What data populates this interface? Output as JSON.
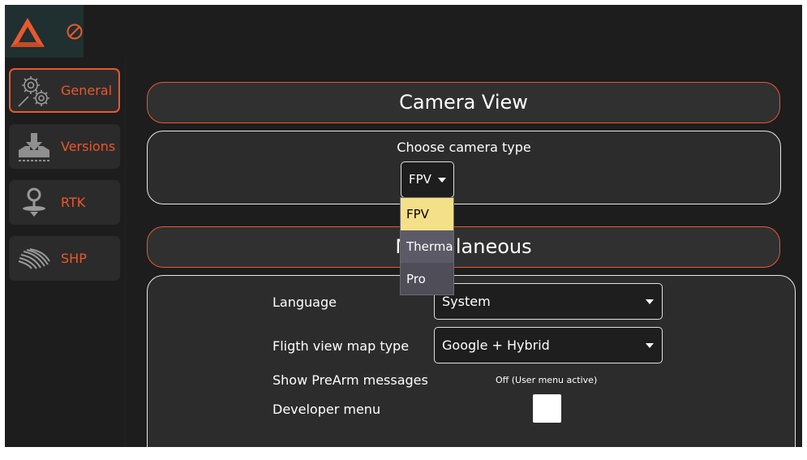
{
  "toolbar": {
    "logo_icon": "orange-triangle-logo-icon",
    "connection_icon": "no-connection-icon",
    "accent_color": "#e9582e"
  },
  "sidebar": {
    "items": [
      {
        "label": "General",
        "icon": "gears-icon",
        "active": true
      },
      {
        "label": "Versions",
        "icon": "download-tray-icon",
        "active": false
      },
      {
        "label": "RTK",
        "icon": "rtk-antenna-icon",
        "active": false
      },
      {
        "label": "SHP",
        "icon": "field-lines-icon",
        "active": false
      }
    ]
  },
  "camera_view": {
    "title": "Camera View",
    "prompt": "Choose camera type",
    "selected": "FPV",
    "options": [
      "FPV",
      "Thermal",
      "Pro"
    ]
  },
  "miscellaneous": {
    "title": "Miscellaneous",
    "language_label": "Language",
    "language_value": "System",
    "map_type_label": "Fligth view map type",
    "map_type_value": "Google + Hybrid",
    "prearm_label": "Show PreArm messages",
    "prearm_status": "Off  (User menu active)",
    "developer_label": "Developer menu"
  }
}
